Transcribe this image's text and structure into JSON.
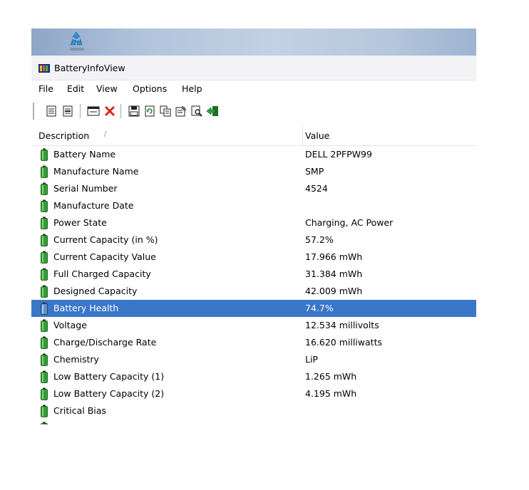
{
  "window": {
    "title": "BatteryInfoView"
  },
  "desktop": {
    "icon": "recycle-bin-icon"
  },
  "menu": [
    "File",
    "Edit",
    "View",
    "Options",
    "Help"
  ],
  "toolbar": {
    "icons": [
      "html-report-all-icon",
      "html-report-selected-icon",
      "properties-window-icon",
      "delete-icon",
      "save-icon",
      "refresh-icon",
      "copy-icon",
      "properties-icon",
      "find-icon",
      "exit-icon"
    ]
  },
  "columns": {
    "description": "Description",
    "value": "Value",
    "sort_indicator": "/"
  },
  "rows": [
    {
      "description": "Battery Name",
      "value": "DELL 2PFPW99"
    },
    {
      "description": "Manufacture Name",
      "value": "SMP"
    },
    {
      "description": "Serial Number",
      "value": "4524"
    },
    {
      "description": "Manufacture Date",
      "value": ""
    },
    {
      "description": "Power State",
      "value": "Charging, AC Power"
    },
    {
      "description": "Current Capacity (in %)",
      "value": "57.2%"
    },
    {
      "description": "Current Capacity Value",
      "value": "17.966 mWh"
    },
    {
      "description": "Full Charged Capacity",
      "value": "31.384 mWh"
    },
    {
      "description": "Designed Capacity",
      "value": "42.009 mWh"
    },
    {
      "description": "Battery Health",
      "value": "74.7%",
      "selected": true
    },
    {
      "description": "Voltage",
      "value": "12.534 millivolts"
    },
    {
      "description": "Charge/Discharge Rate",
      "value": "16.620 milliwatts"
    },
    {
      "description": "Chemistry",
      "value": "LiP"
    },
    {
      "description": "Low Battery Capacity (1)",
      "value": "1.265 mWh"
    },
    {
      "description": "Low Battery Capacity (2)",
      "value": "4.195 mWh"
    },
    {
      "description": "Critical Bias",
      "value": ""
    }
  ],
  "colors": {
    "selection": "#3a77c9",
    "battery_green": "#2fa12f"
  }
}
